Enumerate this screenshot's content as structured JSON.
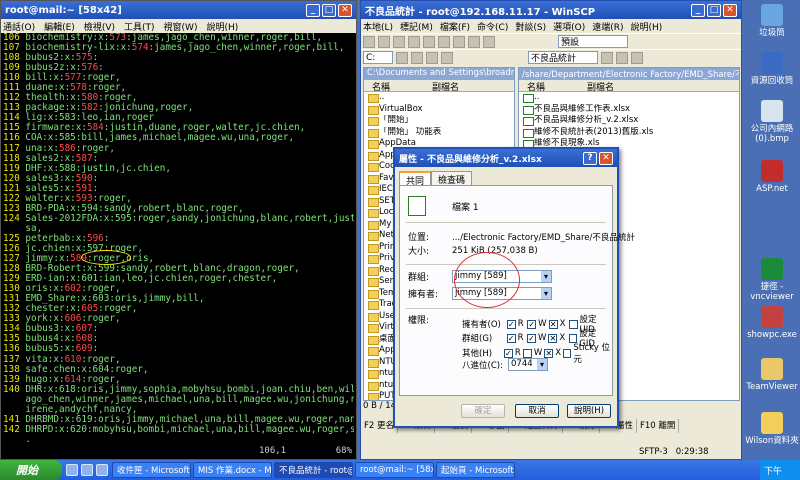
{
  "putty": {
    "title": "root@mail:~ [58x42]",
    "menu": [
      "通話(O)",
      "編輯(E)",
      "檢視(V)",
      "工具(T)",
      "視窗(W)",
      "說明(H)"
    ],
    "lines": [
      {
        "n": "106",
        "p": "biochemistry:x:",
        "c": "573",
        "r": ":james,jago_chen,winner,roger,bill,"
      },
      {
        "n": "107",
        "p": "biochemistry-lix:x:",
        "c": "574",
        "r": ":james,jago_chen,winner,roger,bill,"
      },
      {
        "n": "108",
        "p": "bubus2:x:",
        "c": "575",
        "r": ":"
      },
      {
        "n": "109",
        "p": "bubus2z:x:",
        "c": "576",
        "r": ":"
      },
      {
        "n": "110",
        "p": "bill:x:",
        "c": "577",
        "r": ":roger,"
      },
      {
        "n": "111",
        "p": "duane:x:",
        "c": "578",
        "r": ":roger,"
      },
      {
        "n": "112",
        "p": "thealth:x:",
        "c": "580",
        "r": ":roger,"
      },
      {
        "n": "113",
        "p": "package:x:",
        "c": "582",
        "r": ":jonichung,roger,"
      },
      {
        "n": "114",
        "p": "lig:x:583:leo,ian,roger",
        "c": "",
        "r": ""
      },
      {
        "n": "115",
        "p": "firmware:x:",
        "c": "584",
        "r": ":justin,duane,roger,walter,jc.chien,"
      },
      {
        "n": "116",
        "p": "COA:x:585:bill,james,michael,magee.wu,una,roger,",
        "c": "",
        "r": ""
      },
      {
        "n": "117",
        "p": "una:x:",
        "c": "586",
        "r": ":roger,"
      },
      {
        "n": "118",
        "p": "sales2:x:",
        "c": "587",
        "r": ":"
      },
      {
        "n": "119",
        "p": "DHF:x:588:justin,jc.chien,",
        "c": "",
        "r": ""
      },
      {
        "n": "120",
        "p": "sales3:x:",
        "c": "590",
        "r": ":"
      },
      {
        "n": "121",
        "p": "sales5:x:",
        "c": "591",
        "r": ":"
      },
      {
        "n": "122",
        "p": "walter:x:",
        "c": "593",
        "r": ":roger,"
      },
      {
        "n": "123",
        "p": "BRD-PDA:x:594:sandy,robert,blanc,roger,",
        "c": "",
        "r": ""
      },
      {
        "n": "124",
        "p": "Sales-2012FDA:x:595:roger,sandy,jonichung,blanc,robert,justin,ro",
        "c": "",
        "r": ""
      },
      {
        "n": "",
        "p": "sa,",
        "c": "",
        "r": ""
      },
      {
        "n": "125",
        "p": "peterbab:x:",
        "c": "596",
        "r": ":"
      },
      {
        "n": "126",
        "p": "jc.chien:x:597:roger,",
        "c": "",
        "r": ""
      },
      {
        "n": "127",
        "p": "jimmy:x:",
        "c": "589",
        "r": ":roger,oris,"
      },
      {
        "n": "128",
        "p": "BRD-Robert:x:599:sandy,robert,blanc,dragon,roger,",
        "c": "",
        "r": ""
      },
      {
        "n": "129",
        "p": "ERD-ian:x:601:ian,leo,jc.chien,roger,chester,",
        "c": "",
        "r": ""
      },
      {
        "n": "130",
        "p": "oris:x:",
        "c": "602",
        "r": ":roger,"
      },
      {
        "n": "131",
        "p": "EMD_Share:x:603:oris,jimmy,bill,",
        "c": "",
        "r": ""
      },
      {
        "n": "132",
        "p": "chester:x:",
        "c": "605",
        "r": ":roger,"
      },
      {
        "n": "133",
        "p": "york:x:",
        "c": "606",
        "r": ":roger,"
      },
      {
        "n": "134",
        "p": "bubus3:x:",
        "c": "607",
        "r": ":"
      },
      {
        "n": "135",
        "p": "bubus4:x:",
        "c": "608",
        "r": ":"
      },
      {
        "n": "136",
        "p": "bubus5:x:",
        "c": "609",
        "r": ":"
      },
      {
        "n": "137",
        "p": "vita:x:",
        "c": "610",
        "r": ":roger,"
      },
      {
        "n": "138",
        "p": "safe.chen:x:604:roger,",
        "c": "",
        "r": ""
      },
      {
        "n": "139",
        "p": "hugo:x:",
        "c": "614",
        "r": ":roger,"
      },
      {
        "n": "140",
        "p": "DHR:x:618:oris,jimmy,sophia,mobyhsu,bombi,joan.chiu,ben,wilson,j",
        "c": "",
        "r": ""
      },
      {
        "n": "",
        "p": "ago_chen,winner,james,michael,una,bill,magee.wu,jonichung,roger,",
        "c": "",
        "r": ""
      },
      {
        "n": "",
        "p": "irene,andychf,nancy,",
        "c": "",
        "r": ""
      },
      {
        "n": "141",
        "p": "DHRBMD:x:619:oris,jimmy,michael,una,bill,magee.wu,roger,nancy,",
        "c": "",
        "r": ""
      },
      {
        "n": "142",
        "p": "DHRPD:x:620:mobyhsu,bombi,michael,una,bill,magee.wu,roger,sophia",
        "c": "",
        "r": ""
      },
      {
        "n": "",
        "p": ".",
        "c": "",
        "r": ""
      }
    ],
    "status_pos": "106,1",
    "status_pct": "68%"
  },
  "winscp": {
    "title": "不良品統計 - root@192.168.11.17 - WinSCP",
    "menu": [
      "本地(L)",
      "標記(M)",
      "檔案(F)",
      "命令(C)",
      "對談(S)",
      "選項(O)",
      "遠端(R)",
      "說明(H)"
    ],
    "preset": "預設",
    "left_drive": "C:",
    "right_dir": "不良品統計",
    "left_path": "C:\\Documents and Settings\\broadmaster",
    "right_path": "/share/Department/Electronic Factory/EMD_Share/不良品統計",
    "col_name": "名稱",
    "col_ext": "副檔名",
    "left_items": [
      "..",
      "VirtualBox",
      "「開始」",
      "「開始」 功能表",
      "AppData",
      "Application Data",
      "Cookies",
      "Favorites",
      "IECompatCache",
      "SETUP",
      "Local Settings",
      "My Documents",
      "NetHood",
      "PrintHood",
      "Privacy",
      "Recent",
      "SendTo",
      "Templates",
      "Tracing",
      "UserData",
      "VirtualBox VMs",
      "桌面",
      "Application",
      "NTUSER",
      "ntuser",
      "ntuser",
      "PUTTY",
      "Zincpe"
    ],
    "right_items": [
      "..",
      "不良品與維修工作表.xlsx",
      "不良品與維修分析_v.2.xlsx",
      "維修不良統計表(2013)舊版.xls",
      "維修不良現象.xls"
    ],
    "info": "0 B / 14.0",
    "info2": "0 B / 1",
    "fkeys": [
      "F2 更名",
      "F4 編輯",
      "F5 複製",
      "F6 移動",
      "F7 建立目錄",
      "F8 刪除",
      "F9 屬性",
      "F10 離開"
    ],
    "sftp": "SFTP-3",
    "time": "0:29:38"
  },
  "dialog": {
    "title": "屬性 - 不良品與維修分析_v.2.xlsx",
    "tab_common": "共同",
    "tab_checksum": "檢查碼",
    "file_count": "檔案 1",
    "location_label": "位置:",
    "location_value": ".../Electronic Factory/EMD_Share/不良品統計",
    "size_label": "大小:",
    "size_value": "251 KiB (257,038 B)",
    "group_label": "群組:",
    "group_value": "jimmy [589]",
    "owner_label": "擁有者:",
    "owner_value": "jimmy [589]",
    "perm_label": "權限:",
    "perm_rows": [
      {
        "label": "擁有者(O)",
        "r": "✓",
        "w": "✓",
        "x": "✕",
        "extra": "設定 UID"
      },
      {
        "label": "群組(G)",
        "r": "✓",
        "w": "✓",
        "x": "✕",
        "extra": "設定 GID"
      },
      {
        "label": "其他(H)",
        "r": "✓",
        "w": "",
        "x": "✕",
        "extra": "Sticky 位元"
      }
    ],
    "r_label": "R",
    "w_label": "W",
    "x_label": "X",
    "octal_label": "八進位(C):",
    "octal_value": "0744",
    "ok": "確定",
    "cancel": "取消",
    "help": "說明(H)"
  },
  "desktop_icons": [
    {
      "label": "垃圾筒",
      "color": "#6aa7e0"
    },
    {
      "label": "資源回收筒",
      "color": "#3a6bc4"
    },
    {
      "label": "公司內網路(0).bmp",
      "color": "#d8e3f0"
    },
    {
      "label": "ASP.net",
      "color": "#c22c2c"
    },
    {
      "label": "捷徑 - vncviewer",
      "color": "#1b8a3b"
    },
    {
      "label": "showpc.exe",
      "color": "#c24141"
    },
    {
      "label": "TeamViewer",
      "color": "#e8c86b"
    },
    {
      "label": "Wilson資料夾",
      "color": "#f2cf5a"
    }
  ],
  "taskbar": {
    "start": "開始",
    "buttons": [
      "收件匣 - Microsoft O...",
      "MIS 作業.docx - Micr...",
      "不良品統計 - root@1...",
      "root@mail:~ [58x42]",
      "起始頁 - Microsoft Vi..."
    ],
    "tray": "下午"
  },
  "colors": {
    "term_fg": "#7fe07a",
    "term_num": "#e8e800",
    "term_hl": "#ff4a4a",
    "title": "#2350b8"
  }
}
